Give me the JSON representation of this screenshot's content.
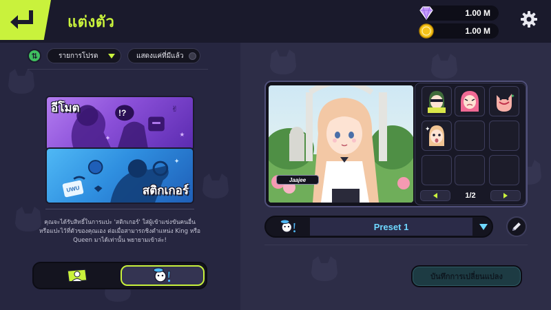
{
  "header": {
    "title": "แต่งตัว",
    "back_icon": "return-arrow-icon",
    "accent_color": "#c9f23c"
  },
  "currencies": {
    "gems": "1.00 M",
    "coins": "1.00 M",
    "gem_icon": "diamond-icon",
    "coin_icon": "coin-icon"
  },
  "settings_icon": "gear-icon",
  "filters": {
    "sort_icon": "sort-icon",
    "category": "รายการโปรด",
    "owned_only_label": "แสดงแค่ที่มีแล้ว"
  },
  "banners": {
    "emote_label": "อีโมต",
    "sticker_label": "สติกเกอร์",
    "sticker_tag": "UWU",
    "emote_symbol": "!?"
  },
  "description": "คุณจะได้รับสิทธิ์ในการแปะ 'สติกเกอร์' ใส่ผู้เข้าแข่งขันคนอื่น หรือแปะไว้ที่ตัวของคุณเอง ต่อเมื่อสามารถชิงตำแหน่ง King หรือ Queen มาได้เท่านั้น พยายามเข้าล่ะ!",
  "mode_toggle": {
    "selected": "sticker",
    "emote_icon": "emote-card-icon",
    "sticker_icon": "sticker-face-icon"
  },
  "showcase": {
    "character_name": "Jaajee",
    "page": "1/2",
    "sticker_slots": [
      {
        "icon": "green-hair-sticker-icon",
        "filled": true
      },
      {
        "icon": "pink-hair-sticker-icon",
        "filled": true
      },
      {
        "icon": "fox-sticker-icon",
        "filled": true
      },
      {
        "icon": "surprised-sticker-icon",
        "filled": true
      },
      {
        "icon": "",
        "filled": false
      },
      {
        "icon": "",
        "filled": false
      },
      {
        "icon": "",
        "filled": false
      },
      {
        "icon": "",
        "filled": false
      },
      {
        "icon": "",
        "filled": false
      }
    ]
  },
  "preset": {
    "label": "Preset 1",
    "icon": "sticker-face-icon",
    "edit_icon": "pencil-icon"
  },
  "save_button": "บันทึกการเปลี่ยนแปลง"
}
